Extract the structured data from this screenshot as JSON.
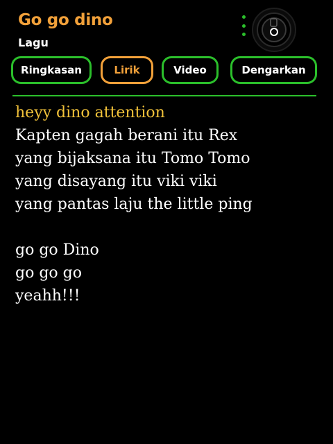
{
  "header": {
    "title": "Go go dino",
    "subtitle": "Lagu",
    "menu_icon": "more-vert-icon",
    "camera_icon": "camera-lens-icon"
  },
  "tabs": [
    {
      "label": "Ringkasan",
      "active": false
    },
    {
      "label": "Lirik",
      "active": true
    },
    {
      "label": "Video",
      "active": false
    },
    {
      "label": "Dengarkan",
      "active": false
    }
  ],
  "lyrics": {
    "heading": "heyy dino attention",
    "verse1": [
      "Kapten gagah berani itu Rex",
      "yang bijaksana itu Tomo Tomo",
      "yang disayang itu viki viki",
      "yang pantas laju the little ping"
    ],
    "verse2": [
      "go go Dino",
      "go go go",
      "yeahh!!!"
    ]
  },
  "colors": {
    "background": "#000000",
    "accent_orange": "#f2a13a",
    "accent_green": "#2bbf2b",
    "heading_yellow": "#f2c23a",
    "text": "#ffffff"
  }
}
